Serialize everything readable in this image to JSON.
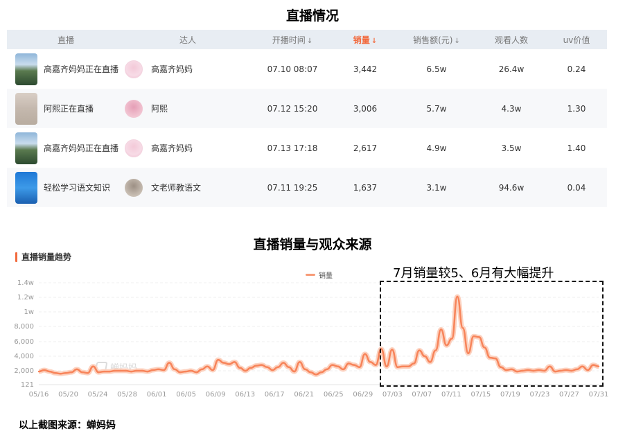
{
  "title_table": "直播情况",
  "title_chart": "直播销量与观众来源",
  "table": {
    "headers": {
      "live": "直播",
      "influencer": "达人",
      "start_time": "开播时间",
      "sales": "销量",
      "revenue": "销售额(元)",
      "viewers": "观看人数",
      "uv": "uv价值"
    },
    "rows": [
      {
        "live": "高嘉齐妈妈正在直播",
        "influencer": "高嘉齐妈妈",
        "start_time": "07.10 08:07",
        "sales": "3,442",
        "revenue": "6.5w",
        "viewers": "26.4w",
        "uv": "0.24"
      },
      {
        "live": "阿熙正在直播",
        "influencer": "阿熙",
        "start_time": "07.12 15:20",
        "sales": "3,006",
        "revenue": "5.7w",
        "viewers": "4.3w",
        "uv": "1.30"
      },
      {
        "live": "高嘉齐妈妈正在直播",
        "influencer": "高嘉齐妈妈",
        "start_time": "07.13 17:18",
        "sales": "2,617",
        "revenue": "4.9w",
        "viewers": "3.5w",
        "uv": "1.40"
      },
      {
        "live": "轻松学习语文知识",
        "influencer": "文老师教语文",
        "start_time": "07.11 19:25",
        "sales": "1,637",
        "revenue": "3.1w",
        "viewers": "94.6w",
        "uv": "0.04"
      }
    ]
  },
  "chart_header": "直播销量趋势",
  "legend": "销量",
  "annotation": "7月销量较5、6月有大幅提升",
  "watermark": "蝉妈妈",
  "source": "以上截图来源：蝉妈妈",
  "colors": {
    "accent": "#f26a3d",
    "line": "#f7845a",
    "header_bg": "#e8edf3"
  },
  "chart_data": {
    "type": "line",
    "series": [
      {
        "name": "销量",
        "values": [
          1900,
          2100,
          1900,
          1700,
          1600,
          1700,
          1800,
          2200,
          1800,
          1700,
          2600,
          1800,
          1900,
          1900,
          2000,
          2000,
          2000,
          1900,
          2000,
          2000,
          1900,
          2100,
          2200,
          2100,
          3100,
          2200,
          1800,
          1900,
          2000,
          1800,
          2200,
          2600,
          2100,
          3500,
          3100,
          2900,
          3200,
          2400,
          2000,
          2400,
          2700,
          2800,
          2500,
          2100,
          2500,
          3100,
          2500,
          1900,
          3200,
          2200,
          1800,
          1500,
          1800,
          2200,
          2800,
          2600,
          2200,
          3000,
          2800,
          2500,
          4300,
          3200,
          2800,
          5000,
          2600,
          4900,
          2500,
          2600,
          2600,
          3000,
          4800,
          4000,
          3200,
          4800,
          7600,
          5500,
          6400,
          12100,
          7800,
          4400,
          6700,
          6600,
          5200,
          3800,
          3700,
          2500,
          2100,
          2200,
          1900,
          2000,
          2100,
          2000,
          2100,
          2000,
          2600,
          1900,
          2000,
          2100,
          2000,
          2200,
          2600,
          2100,
          2800,
          2600
        ]
      }
    ],
    "x_ticks": [
      "05/16",
      "05/20",
      "05/24",
      "05/28",
      "06/01",
      "06/05",
      "06/09",
      "06/13",
      "06/17",
      "06/21",
      "06/25",
      "06/29",
      "07/03",
      "07/07",
      "07/11",
      "07/15",
      "07/19",
      "07/23",
      "07/27",
      "07/31"
    ],
    "y_ticks": [
      "121",
      "2,000",
      "4,000",
      "6,000",
      "8,000",
      "1w",
      "1.2w",
      "1.4w"
    ],
    "y_tick_values": [
      121,
      2000,
      4000,
      6000,
      8000,
      10000,
      12000,
      14000
    ],
    "ylim": [
      121,
      14000
    ],
    "grid": true,
    "legend": "top"
  }
}
